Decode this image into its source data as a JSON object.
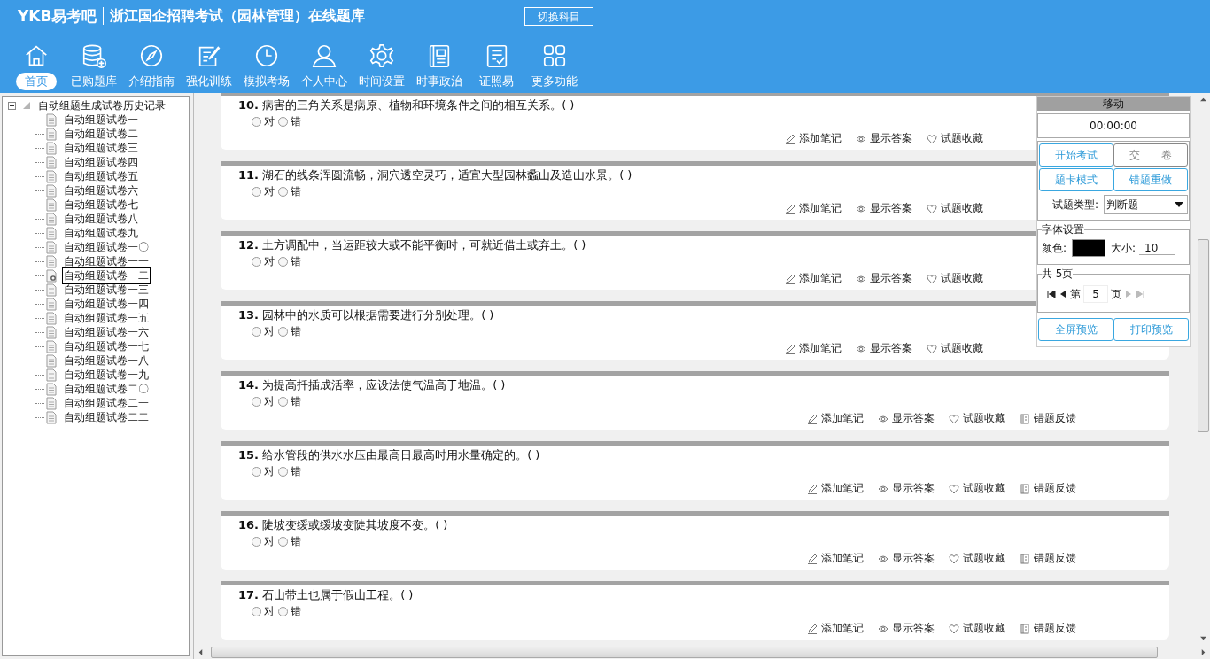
{
  "header": {
    "logo": "YKB易考吧",
    "title": "浙江国企招聘考试（园林管理）在线题库",
    "switch_button": "切换科目"
  },
  "toolbar": [
    {
      "kind": "home",
      "label": "首页",
      "selected": true
    },
    {
      "kind": "database",
      "label": "已购题库",
      "selected": false
    },
    {
      "kind": "compass",
      "label": "介绍指南",
      "selected": false
    },
    {
      "kind": "edit",
      "label": "强化训练",
      "selected": false
    },
    {
      "kind": "clock",
      "label": "模拟考场",
      "selected": false
    },
    {
      "kind": "user",
      "label": "个人中心",
      "selected": false
    },
    {
      "kind": "gear",
      "label": "时间设置",
      "selected": false
    },
    {
      "kind": "news",
      "label": "时事政治",
      "selected": false
    },
    {
      "kind": "checklist",
      "label": "证照易",
      "selected": false
    },
    {
      "kind": "grid",
      "label": "更多功能",
      "selected": false
    }
  ],
  "tree": {
    "label": "自动组题生成试卷历史记录",
    "expanded": true,
    "children": [
      {
        "label": "自动组题试卷一",
        "selected": false
      },
      {
        "label": "自动组题试卷二",
        "selected": false
      },
      {
        "label": "自动组题试卷三",
        "selected": false
      },
      {
        "label": "自动组题试卷四",
        "selected": false
      },
      {
        "label": "自动组题试卷五",
        "selected": false
      },
      {
        "label": "自动组题试卷六",
        "selected": false
      },
      {
        "label": "自动组题试卷七",
        "selected": false
      },
      {
        "label": "自动组题试卷八",
        "selected": false
      },
      {
        "label": "自动组题试卷九",
        "selected": false
      },
      {
        "label": "自动组题试卷一〇",
        "selected": false
      },
      {
        "label": "自动组题试卷一一",
        "selected": false
      },
      {
        "label": "自动组题试卷一二",
        "selected": true
      },
      {
        "label": "自动组题试卷一三",
        "selected": false
      },
      {
        "label": "自动组题试卷一四",
        "selected": false
      },
      {
        "label": "自动组题试卷一五",
        "selected": false
      },
      {
        "label": "自动组题试卷一六",
        "selected": false
      },
      {
        "label": "自动组题试卷一七",
        "selected": false
      },
      {
        "label": "自动组题试卷一八",
        "selected": false
      },
      {
        "label": "自动组题试卷一九",
        "selected": false
      },
      {
        "label": "自动组题试卷二〇",
        "selected": false
      },
      {
        "label": "自动组题试卷二一",
        "selected": false
      },
      {
        "label": "自动组题试卷二二",
        "selected": false
      }
    ]
  },
  "questions": [
    {
      "number": "10.",
      "text": "病害的三角关系是病原、植物和环境条件之间的相互关系。( )",
      "options": [
        {
          "label": "对",
          "selected": false
        },
        {
          "label": "错",
          "selected": false
        }
      ],
      "actions": [
        {
          "kind": "note",
          "label": "添加笔记"
        },
        {
          "kind": "answer",
          "label": "显示答案"
        },
        {
          "kind": "favorite",
          "label": "试题收藏"
        }
      ]
    },
    {
      "number": "11.",
      "text": "湖石的线条浑圆流畅，洞穴透空灵巧，适宜大型园林蠡山及造山水景。( )",
      "options": [
        {
          "label": "对",
          "selected": false
        },
        {
          "label": "错",
          "selected": false
        }
      ],
      "actions": [
        {
          "kind": "note",
          "label": "添加笔记"
        },
        {
          "kind": "answer",
          "label": "显示答案"
        },
        {
          "kind": "favorite",
          "label": "试题收藏"
        }
      ]
    },
    {
      "number": "12.",
      "text": "土方调配中，当运距较大或不能平衡时，可就近借土或弃土。( )",
      "options": [
        {
          "label": "对",
          "selected": false
        },
        {
          "label": "错",
          "selected": false
        }
      ],
      "actions": [
        {
          "kind": "note",
          "label": "添加笔记"
        },
        {
          "kind": "answer",
          "label": "显示答案"
        },
        {
          "kind": "favorite",
          "label": "试题收藏"
        }
      ]
    },
    {
      "number": "13.",
      "text": "园林中的水质可以根据需要进行分别处理。( )",
      "options": [
        {
          "label": "对",
          "selected": false
        },
        {
          "label": "错",
          "selected": false
        }
      ],
      "actions": [
        {
          "kind": "note",
          "label": "添加笔记"
        },
        {
          "kind": "answer",
          "label": "显示答案"
        },
        {
          "kind": "favorite",
          "label": "试题收藏"
        }
      ]
    },
    {
      "number": "14.",
      "text": "为提高扦插成活率，应设法使气温高于地温。( )",
      "options": [
        {
          "label": "对",
          "selected": false
        },
        {
          "label": "错",
          "selected": false
        }
      ],
      "actions": [
        {
          "kind": "note",
          "label": "添加笔记"
        },
        {
          "kind": "answer",
          "label": "显示答案"
        },
        {
          "kind": "favorite",
          "label": "试题收藏"
        },
        {
          "kind": "feedback",
          "label": "错题反馈"
        }
      ]
    },
    {
      "number": "15.",
      "text": "给水管段的供水水压由最高日最高时用水量确定的。( )",
      "options": [
        {
          "label": "对",
          "selected": false
        },
        {
          "label": "错",
          "selected": false
        }
      ],
      "actions": [
        {
          "kind": "note",
          "label": "添加笔记"
        },
        {
          "kind": "answer",
          "label": "显示答案"
        },
        {
          "kind": "favorite",
          "label": "试题收藏"
        },
        {
          "kind": "feedback",
          "label": "错题反馈"
        }
      ]
    },
    {
      "number": "16.",
      "text": "陡坡变缓或缓坡变陡其坡度不变。( )",
      "options": [
        {
          "label": "对",
          "selected": false
        },
        {
          "label": "错",
          "selected": false
        }
      ],
      "actions": [
        {
          "kind": "note",
          "label": "添加笔记"
        },
        {
          "kind": "answer",
          "label": "显示答案"
        },
        {
          "kind": "favorite",
          "label": "试题收藏"
        },
        {
          "kind": "feedback",
          "label": "错题反馈"
        }
      ]
    },
    {
      "number": "17.",
      "text": "石山带土也属于假山工程。( )",
      "options": [
        {
          "label": "对",
          "selected": false
        },
        {
          "label": "错",
          "selected": false
        }
      ],
      "actions": [
        {
          "kind": "note",
          "label": "添加笔记"
        },
        {
          "kind": "answer",
          "label": "显示答案"
        },
        {
          "kind": "favorite",
          "label": "试题收藏"
        },
        {
          "kind": "feedback",
          "label": "错题反馈"
        }
      ]
    }
  ],
  "panel": {
    "title": "移动",
    "timer": "00:00:00",
    "buttons": [
      {
        "label": "开始考试",
        "disabled": false
      },
      {
        "label": "交　　卷",
        "disabled": true
      },
      {
        "label": "题卡模式",
        "disabled": false
      },
      {
        "label": "错题重做",
        "disabled": false
      }
    ],
    "type_label": "试题类型:",
    "type_value": "判断题",
    "font": {
      "legend": "字体设置",
      "color_label": "颜色:",
      "color": "#000000",
      "size_label": "大小:",
      "size_value": "10"
    },
    "pages": {
      "legend": "共 5页",
      "prefix": "第",
      "page": "5",
      "suffix": "页"
    },
    "preview_buttons": [
      "全屏预览",
      "打印预览"
    ]
  }
}
